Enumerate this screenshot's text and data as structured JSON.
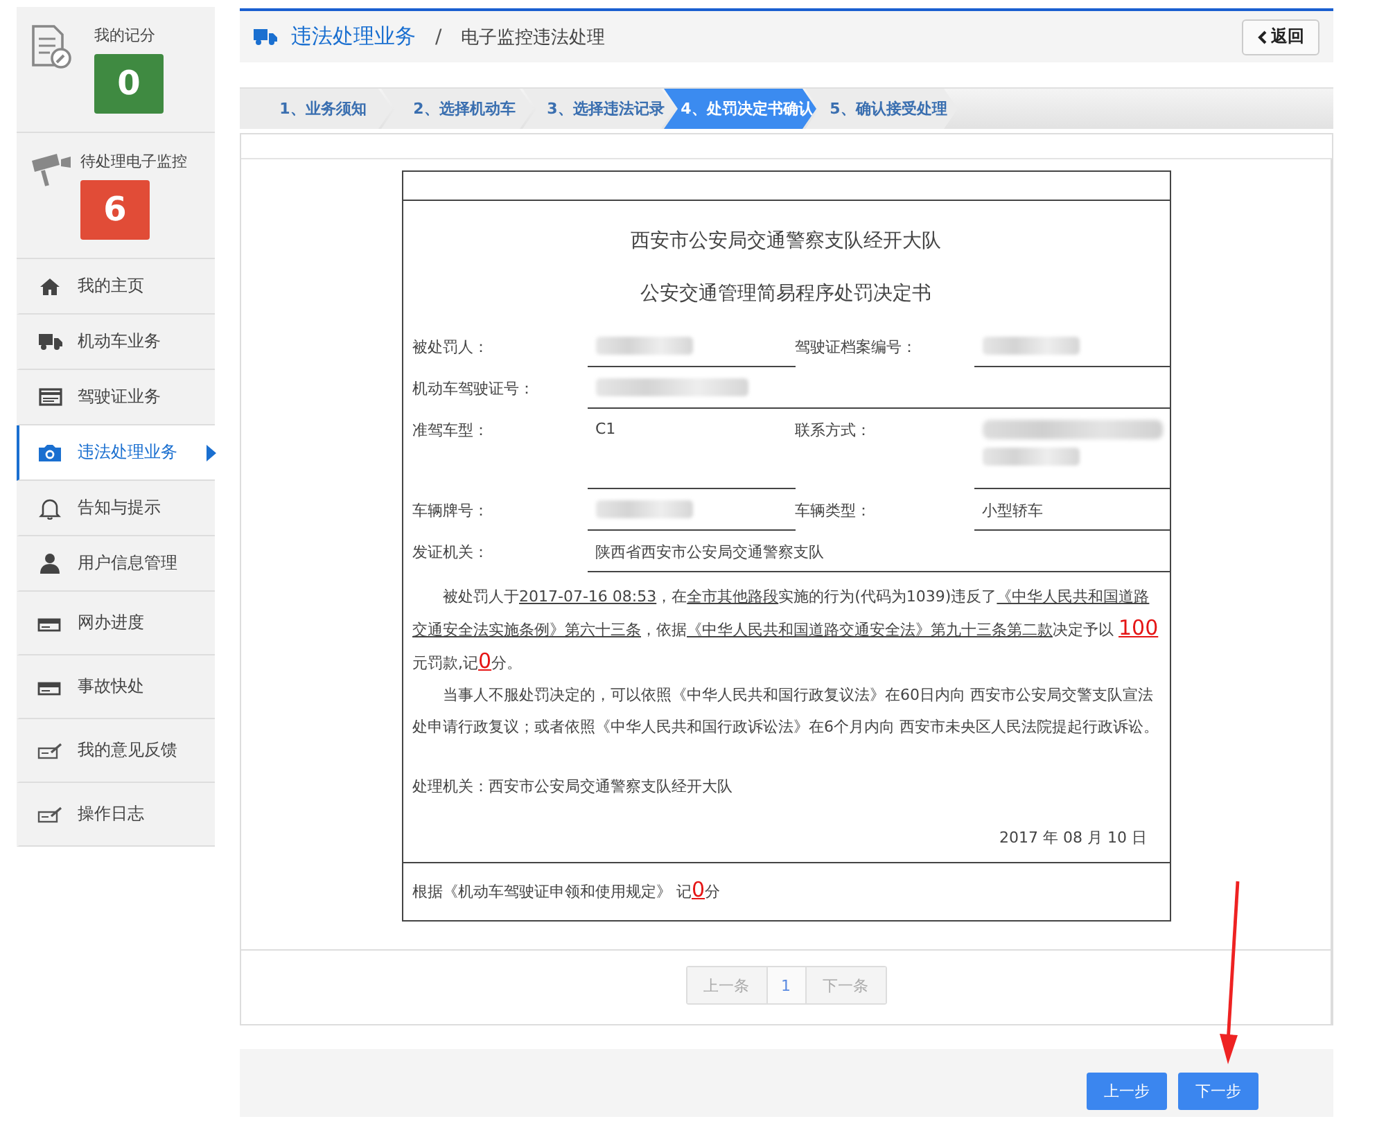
{
  "sidebar": {
    "score_cards": [
      {
        "label": "我的记分",
        "count": "0",
        "color": "#3f8a41"
      },
      {
        "label": "待处理电子监控",
        "count": "6",
        "color": "#e14c37"
      }
    ],
    "items": [
      {
        "label": "我的主页",
        "selected": false
      },
      {
        "label": "机动车业务",
        "selected": false
      },
      {
        "label": "驾驶证业务",
        "selected": false
      },
      {
        "label": "违法处理业务",
        "selected": true
      },
      {
        "label": "告知与提示",
        "selected": false
      },
      {
        "label": "用户信息管理",
        "selected": false
      },
      {
        "label": "网办进度",
        "selected": false
      },
      {
        "label": "事故快处",
        "selected": false
      },
      {
        "label": "我的意见反馈",
        "selected": false
      },
      {
        "label": "操作日志",
        "selected": false
      }
    ]
  },
  "breadcrumb": {
    "section": "违法处理业务",
    "separator": "/",
    "page": "电子监控违法处理"
  },
  "back_button": "返回",
  "steps": [
    {
      "label": "1、业务须知",
      "selected": false
    },
    {
      "label": "2、选择机动车",
      "selected": false
    },
    {
      "label": "3、选择违法记录",
      "selected": false
    },
    {
      "label": "4、处罚决定书确认",
      "selected": true
    },
    {
      "label": "5、确认接受处理",
      "selected": false
    }
  ],
  "document": {
    "authority": "西安市公安局交通警察支队经开大队",
    "title": "公安交通管理简易程序处罚决定书",
    "rows": [
      {
        "cells": [
          {
            "label": "被处罚人：",
            "value": {
              "kind": "blurred"
            }
          },
          {
            "label": "驾驶证档案编号：",
            "value": {
              "kind": "blurred"
            }
          }
        ]
      },
      {
        "cells": [
          {
            "label": "机动车驾驶证号：",
            "value": {
              "kind": "blurred"
            }
          }
        ]
      },
      {
        "cells": [
          {
            "label": "准驾车型：",
            "value": {
              "kind": "text",
              "text": "C1"
            }
          },
          {
            "label": "联系方式：",
            "value": {
              "kind": "blurred_two_lines"
            }
          }
        ]
      },
      {
        "cells": [
          {
            "label": "车辆牌号：",
            "value": {
              "kind": "blurred"
            }
          },
          {
            "label": "车辆类型：",
            "value": {
              "kind": "text",
              "text": "小型轿车"
            }
          }
        ]
      },
      {
        "cells": [
          {
            "label": "发证机关：",
            "value": {
              "kind": "text",
              "text": "陕西省西安市公安局交通警察支队"
            }
          }
        ]
      }
    ],
    "paragraphs": [
      [
        {
          "text": "被处罚人于",
          "kind": "plain"
        },
        {
          "text": "2017-07-16 08:53",
          "kind": "underline"
        },
        {
          "text": "，在",
          "kind": "plain"
        },
        {
          "text": "全市其他路段",
          "kind": "underline"
        },
        {
          "text": "实施的行为(代码为1039)违反了",
          "kind": "plain"
        },
        {
          "text": "《中华人民共和国道路交通安全法实施条例》第六十三条",
          "kind": "underline"
        },
        {
          "text": "，依据",
          "kind": "plain"
        },
        {
          "text": "《中华人民共和国道路交通安全法》第九十三条第二款",
          "kind": "underline"
        },
        {
          "text": "决定予以 ",
          "kind": "plain"
        },
        {
          "text": "100",
          "kind": "highlight"
        },
        {
          "text": "元罚款,记",
          "kind": "plain"
        },
        {
          "text": "0",
          "kind": "highlight"
        },
        {
          "text": "分。",
          "kind": "plain"
        }
      ],
      [
        {
          "text": "当事人不服处罚决定的，可以依照《中华人民共和国行政复议法》在60日内向 西安市公安局交警支队宣法处申请行政复议；或者依照《中华人民共和国行政诉讼法》在6个月内向 西安市未央区人民法院提起行政诉讼。",
          "kind": "plain"
        }
      ]
    ],
    "processing_agency": "处理机关：西安市公安局交通警察支队经开大队",
    "date": "2017 年 08 月 10 日",
    "note": [
      {
        "text": "根据《机动车驾驶证申领和使用规定》 记",
        "kind": "plain"
      },
      {
        "text": "0",
        "kind": "highlight"
      },
      {
        "text": "分",
        "kind": "plain"
      }
    ]
  },
  "pager": {
    "prev": "上一条",
    "page": "1",
    "next": "下一条"
  },
  "footer_buttons": [
    "上一步",
    "下一步"
  ],
  "annotations": [
    {
      "kind": "arrow"
    }
  ]
}
